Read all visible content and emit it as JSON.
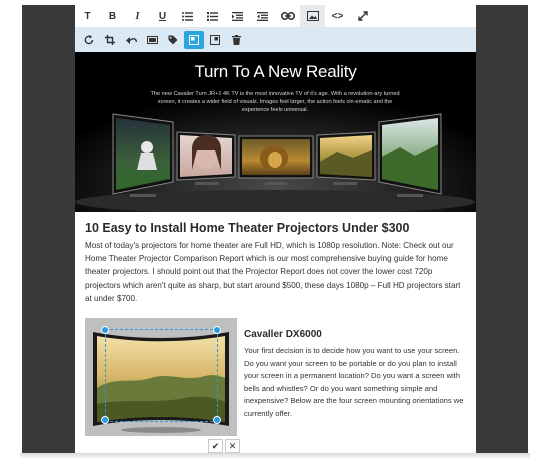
{
  "toolbar_top": {
    "buttons": [
      {
        "name": "bold-text-t",
        "glyph": "T"
      },
      {
        "name": "bold",
        "glyph": "B"
      },
      {
        "name": "italic",
        "glyph": "I"
      },
      {
        "name": "underline",
        "glyph": "U"
      },
      {
        "name": "bulleted-list",
        "glyph": "≔"
      },
      {
        "name": "numbered-list",
        "glyph": "☰"
      },
      {
        "name": "indent",
        "glyph": "⇥"
      },
      {
        "name": "outdent",
        "glyph": "⇤"
      },
      {
        "name": "link",
        "glyph": "⊂⊃"
      },
      {
        "name": "image",
        "glyph": "▣"
      },
      {
        "name": "code",
        "glyph": "<>"
      },
      {
        "name": "fullscreen",
        "glyph": "⤢"
      }
    ]
  },
  "toolbar_image": {
    "buttons": [
      {
        "name": "rotate-icon"
      },
      {
        "name": "crop-icon"
      },
      {
        "name": "flip-icon"
      },
      {
        "name": "frame-icon"
      },
      {
        "name": "tag-icon"
      },
      {
        "name": "align-left-icon",
        "active": true
      },
      {
        "name": "align-right-icon"
      },
      {
        "name": "delete-icon"
      }
    ]
  },
  "banner": {
    "title": "Turn To A New Reality",
    "text": "The new Cavalier Turn JR+1 4K TV is the most innovative TV of it's age. With a revolution-ary turned screen, it creates a wider field of visuals. Images feel larger, the action feels cin-ematic and the experience feels universal."
  },
  "article": {
    "heading": "10 Easy to Install Home Theater Projectors Under $300",
    "paragraph": "Most of today's projectors for home theater are Full HD, which is 1080p resolution.  Note:  Check out our Home Theater Projector Comparison Report  which is our most comprehensive buying guide for home theater projectors.  I should point out that the Projector Report does not cover the lower cost 720p projectors which aren't quite as sharp, but start around $500, these days 1080p – Full HD projectors start at under $700."
  },
  "product": {
    "title": "Cavaller DX6000",
    "text": "Your first decision is to decide how you want to use your screen. Do you want your screen to be portable or do you plan to install your screen in a permanent location? Do you want a screen with bells and whistles? Or do you want something simple and inexpensive? Below are the four screen mounting orientations we currently offer."
  },
  "image_actions": {
    "confirm": "✔",
    "cancel": "✕"
  },
  "colors": {
    "accent": "#2aa5e0",
    "toolbar_bg": "#dbe9f5",
    "frame": "#3a3a3a"
  }
}
